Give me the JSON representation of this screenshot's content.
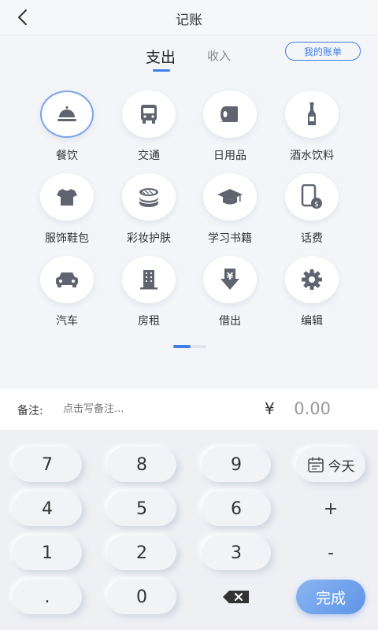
{
  "header": {
    "title": "记账",
    "back_icon": "chevron-left-icon"
  },
  "tabs": {
    "expense": "支出",
    "income": "收入",
    "active": "expense"
  },
  "bill_button": "我的账单",
  "categories": [
    {
      "label": "餐饮",
      "icon": "cloche-icon",
      "selected": true
    },
    {
      "label": "交通",
      "icon": "bus-icon"
    },
    {
      "label": "日用品",
      "icon": "tissue-roll-icon"
    },
    {
      "label": "酒水饮料",
      "icon": "bottle-icon"
    },
    {
      "label": "服饰鞋包",
      "icon": "tshirt-icon"
    },
    {
      "label": "彩妆护肤",
      "icon": "cosmetic-jar-icon"
    },
    {
      "label": "学习书籍",
      "icon": "graduation-cap-icon"
    },
    {
      "label": "话费",
      "icon": "phone-bill-icon"
    },
    {
      "label": "汽车",
      "icon": "car-icon"
    },
    {
      "label": "房租",
      "icon": "building-icon"
    },
    {
      "label": "借出",
      "icon": "yen-down-icon"
    },
    {
      "label": "编辑",
      "icon": "gear-icon"
    }
  ],
  "note": {
    "label": "备注:",
    "placeholder": "点击写备注..."
  },
  "amount": {
    "currency": "¥",
    "value": "0.00"
  },
  "keypad": {
    "row1": [
      "7",
      "8",
      "9",
      "今天"
    ],
    "row2": [
      "4",
      "5",
      "6",
      "+"
    ],
    "row3": [
      "1",
      "2",
      "3",
      "-"
    ],
    "row4": [
      ".",
      "0",
      "",
      "完成"
    ]
  },
  "colors": {
    "accent": "#3f7ee8",
    "icon": "#5f6470"
  }
}
